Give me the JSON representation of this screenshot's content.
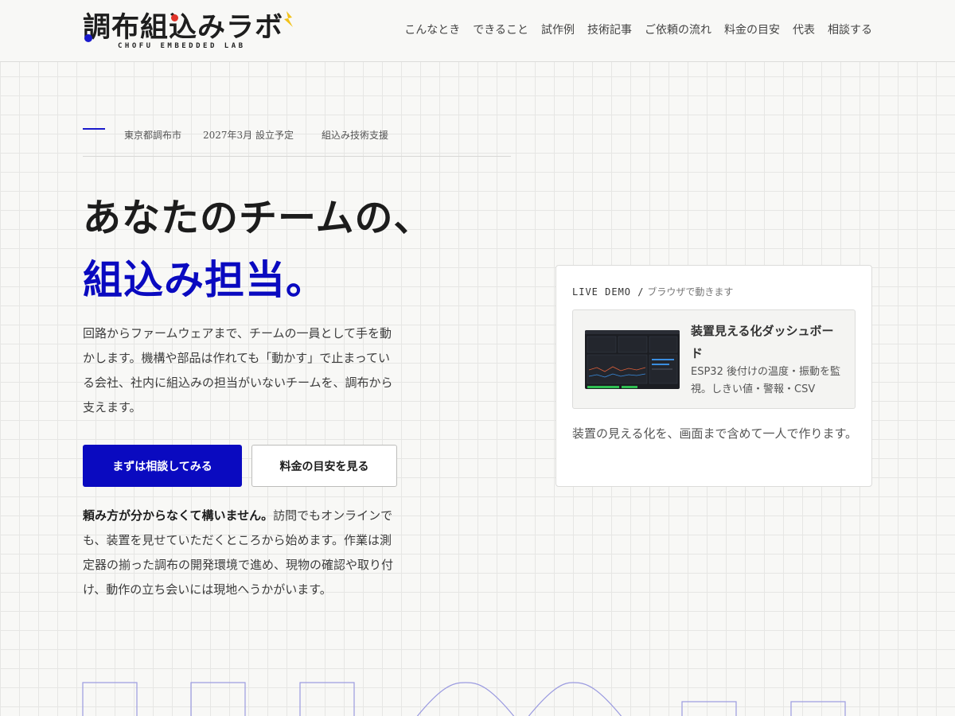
{
  "header": {
    "logo_title": "調布組込みラボ",
    "logo_subtitle": "CHOFU EMBEDDED LAB",
    "nav": [
      {
        "label": "こんなとき"
      },
      {
        "label": "できること"
      },
      {
        "label": "試作例"
      },
      {
        "label": "技術記事"
      },
      {
        "label": "ご依頼の流れ"
      },
      {
        "label": "料金の目安"
      },
      {
        "label": "代表"
      },
      {
        "label": "相談する"
      }
    ]
  },
  "hero": {
    "meta": [
      "東京都調布市",
      "2027年3月 設立予定",
      "組込み技術支援"
    ],
    "headline_1": "あなたのチームの、",
    "headline_2": "組込み担当。",
    "lead": "回路からファームウェアまで、チームの一員として手を動かします。機構や部品は作れても「動かす」で止まっている会社、社内に組込みの担当がいないチームを、調布から支えます。",
    "cta_primary": "まずは相談してみる",
    "cta_secondary": "料金の目安を見る",
    "note_strong": "頼み方が分からなくて構いません。",
    "note_rest": "訪問でもオンラインでも、装置を見せていただくところから始めます。作業は測定器の揃った調布の開発環境で進め、現物の確認や取り付け、動作の立ち会いには現地へうかがいます。"
  },
  "demo": {
    "label_mono": "LIVE DEMO /",
    "label_serif": "ブラウザで動きます",
    "item_title": "装置見える化ダッシュボード",
    "item_desc": "ESP32 後付けの温度・振動を監視。しきい値・警報・CSV",
    "caption": "装置の見える化を、画面まで含めて一人で作ります。"
  },
  "colors": {
    "accent": "#0a0ac0",
    "background": "#f8f8f6",
    "text": "#1c1c1c"
  }
}
